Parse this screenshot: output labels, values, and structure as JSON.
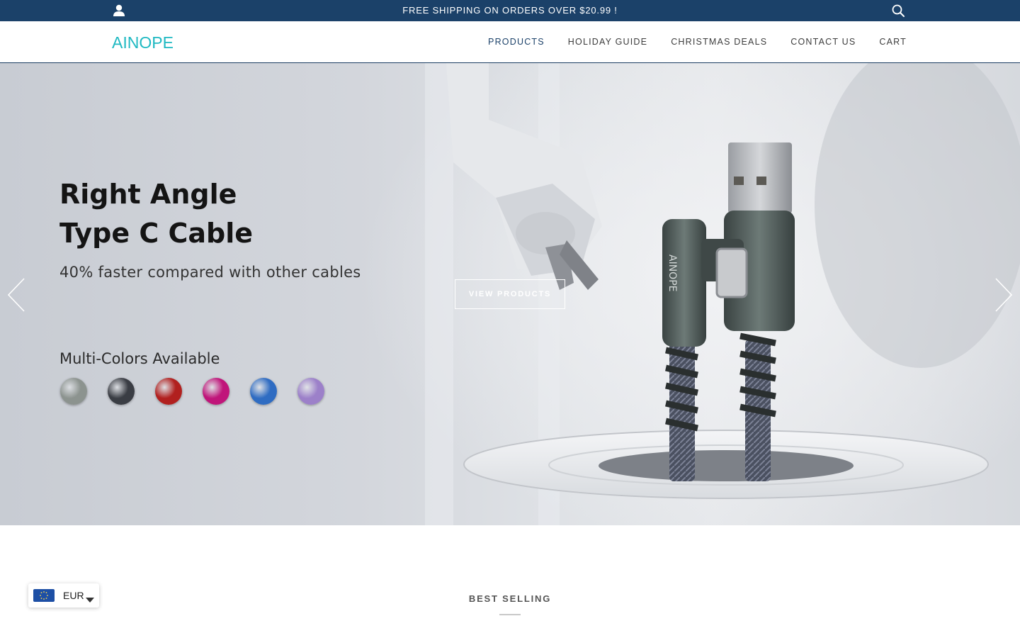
{
  "announcement": {
    "text": "FREE SHIPPING ON ORDERS OVER $20.99 !",
    "account_icon": "user-icon",
    "search_icon": "search-icon"
  },
  "header": {
    "logo_text": "AINOPE",
    "nav": [
      {
        "label": "PRODUCTS",
        "active": true
      },
      {
        "label": "HOLIDAY GUIDE",
        "active": false
      },
      {
        "label": "CHRISTMAS DEALS",
        "active": false
      },
      {
        "label": "CONTACT US",
        "active": false
      },
      {
        "label": "CART",
        "active": false
      }
    ]
  },
  "hero": {
    "title_line1": "Right Angle",
    "title_line2": "Type C Cable",
    "subtitle": "40% faster compared with other cables",
    "colors_label": "Multi-Colors Available",
    "cable_brand_text": "AINOPE",
    "swatch_colors": [
      "#8c938f",
      "#3a3d44",
      "#b1201f",
      "#c0157a",
      "#2f6cc2",
      "#9c80c9"
    ],
    "cta_label": "VIEW PRODUCTS",
    "prev_icon": "chevron-left-icon",
    "next_icon": "chevron-right-icon"
  },
  "best_selling": {
    "title": "BEST SELLING"
  },
  "currency": {
    "code": "EUR",
    "flag_icon": "eu-flag-icon",
    "caret_icon": "caret-down-icon"
  },
  "colors": {
    "announcement_bg": "#1b4169",
    "logo": "#1fb9c2",
    "nav_active": "#1b4169"
  }
}
